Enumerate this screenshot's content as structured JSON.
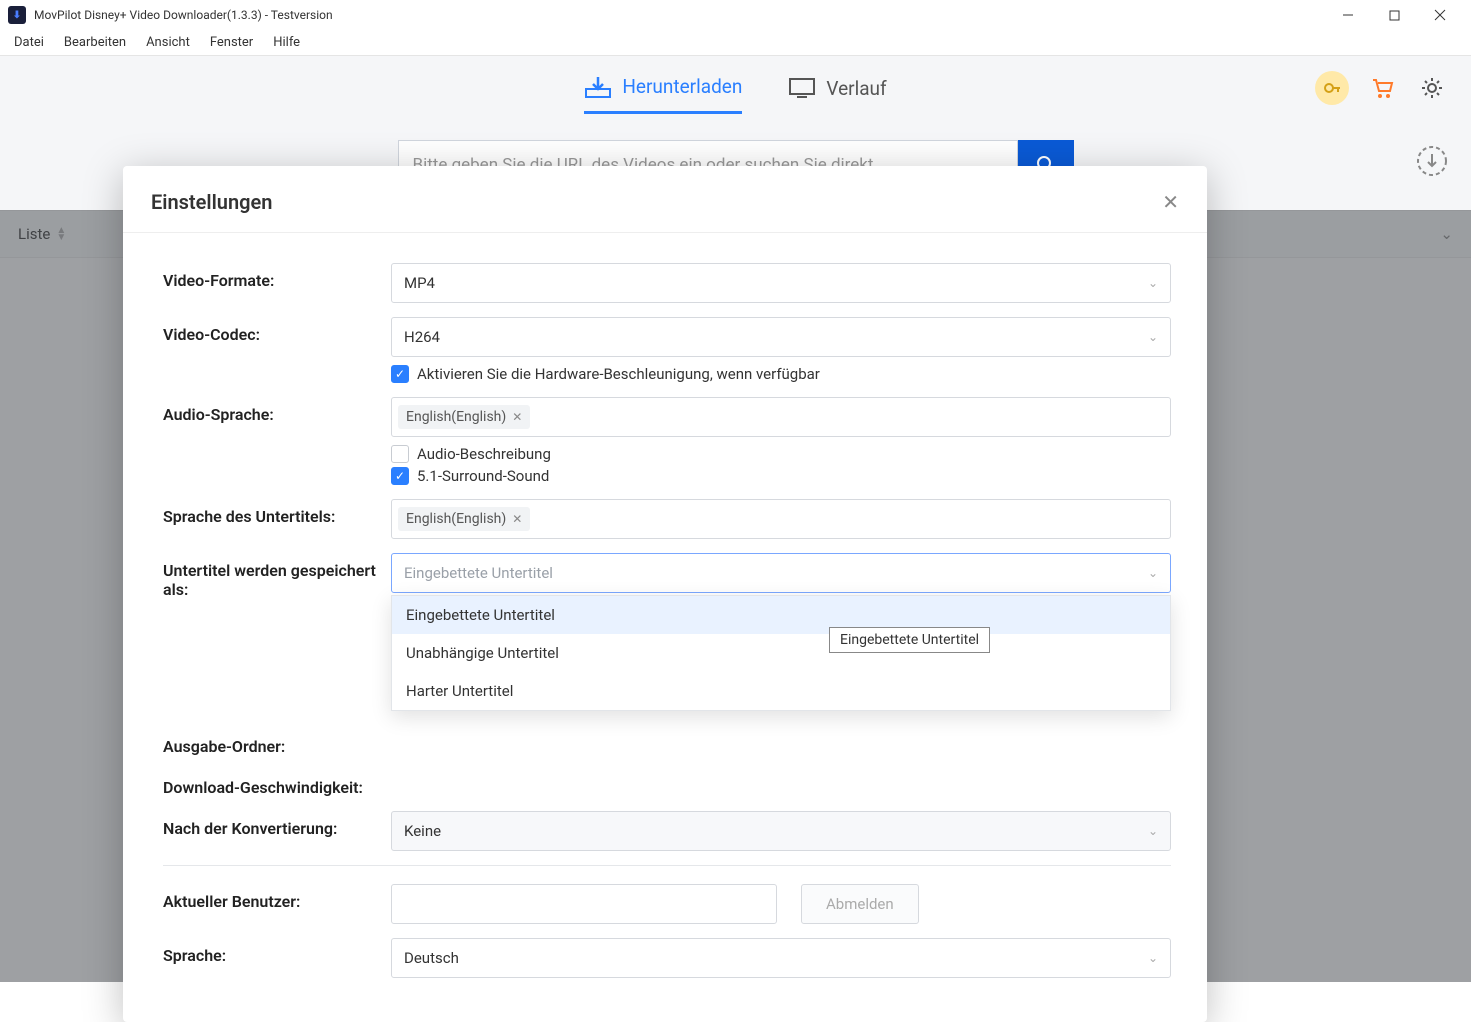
{
  "window": {
    "title": "MovPilot Disney+ Video Downloader(1.3.3) - Testversion"
  },
  "menu": {
    "file": "Datei",
    "edit": "Bearbeiten",
    "view": "Ansicht",
    "window": "Fenster",
    "help": "Hilfe"
  },
  "tabs": {
    "download": "Herunterladen",
    "history": "Verlauf"
  },
  "search": {
    "placeholder": "Bitte geben Sie die URL des Videos ein oder suchen Sie direkt ..."
  },
  "list_header": "Liste",
  "modal": {
    "title": "Einstellungen",
    "labels": {
      "video_format": "Video-Formate:",
      "video_codec": "Video-Codec:",
      "audio_language": "Audio-Sprache:",
      "subtitle_language": "Sprache des Untertitels:",
      "subtitle_save_as": "Untertitel werden gespeichert als:",
      "output_folder": "Ausgabe-Ordner:",
      "download_speed": "Download-Geschwindigkeit:",
      "after_conversion": "Nach der Konvertierung:",
      "current_user": "Aktueller Benutzer:",
      "language": "Sprache:"
    },
    "values": {
      "video_format": "MP4",
      "video_codec": "H264",
      "hw_accel": "Aktivieren Sie die Hardware-Beschleunigung, wenn verfügbar",
      "audio_lang_chip": "English(English)",
      "audio_desc": "Audio-Beschreibung",
      "surround": "5.1-Surround-Sound",
      "sub_lang_chip": "English(English)",
      "sub_save_placeholder": "Eingebettete Untertitel",
      "after_conversion": "Keine",
      "logout": "Abmelden",
      "language": "Deutsch"
    },
    "dropdown": {
      "opt1": "Eingebettete Untertitel",
      "opt2": "Unabhängige Untertitel",
      "opt3": "Harter Untertitel"
    },
    "tooltip": "Eingebettete Untertitel"
  }
}
